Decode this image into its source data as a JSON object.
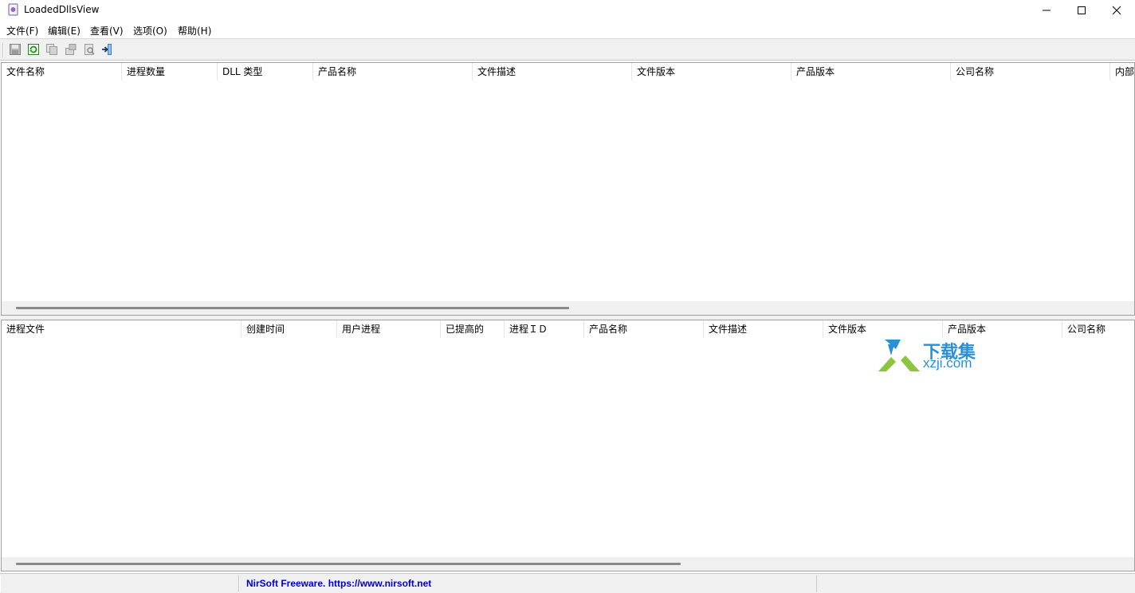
{
  "window": {
    "title": "LoadedDllsView",
    "min_glyph": "—",
    "max_glyph": "☐",
    "close_glyph": "✕"
  },
  "menu": [
    {
      "label": "文件(F)"
    },
    {
      "label": "编辑(E)"
    },
    {
      "label": "查看(V)"
    },
    {
      "label": "选项(O)"
    },
    {
      "label": "帮助(H)"
    }
  ],
  "toolbar": {
    "icons": [
      "save-icon",
      "refresh-icon",
      "copy-icon",
      "properties-icon",
      "find-icon",
      "exit-icon"
    ]
  },
  "dll_table": {
    "columns": [
      "文件名称",
      "进程数量",
      "DLL 类型",
      "产品名称",
      "文件描述",
      "文件版本",
      "产品版本",
      "公司名称",
      "内部名称"
    ]
  },
  "process_table": {
    "columns": [
      "进程文件",
      "创建时间",
      "用户进程",
      "已提高的",
      "进程ＩＤ",
      "产品名称",
      "文件描述",
      "文件版本",
      "产品版本",
      "公司名称"
    ]
  },
  "status": {
    "link": "NirSoft Freeware. https://www.nirsoft.net"
  },
  "watermark": {
    "text_cn": "下载集",
    "text_en": "xzji.com"
  },
  "colors": {
    "link": "#0000cc",
    "watermark_blue": "#2a8fd6",
    "watermark_green": "#8cc63f"
  }
}
